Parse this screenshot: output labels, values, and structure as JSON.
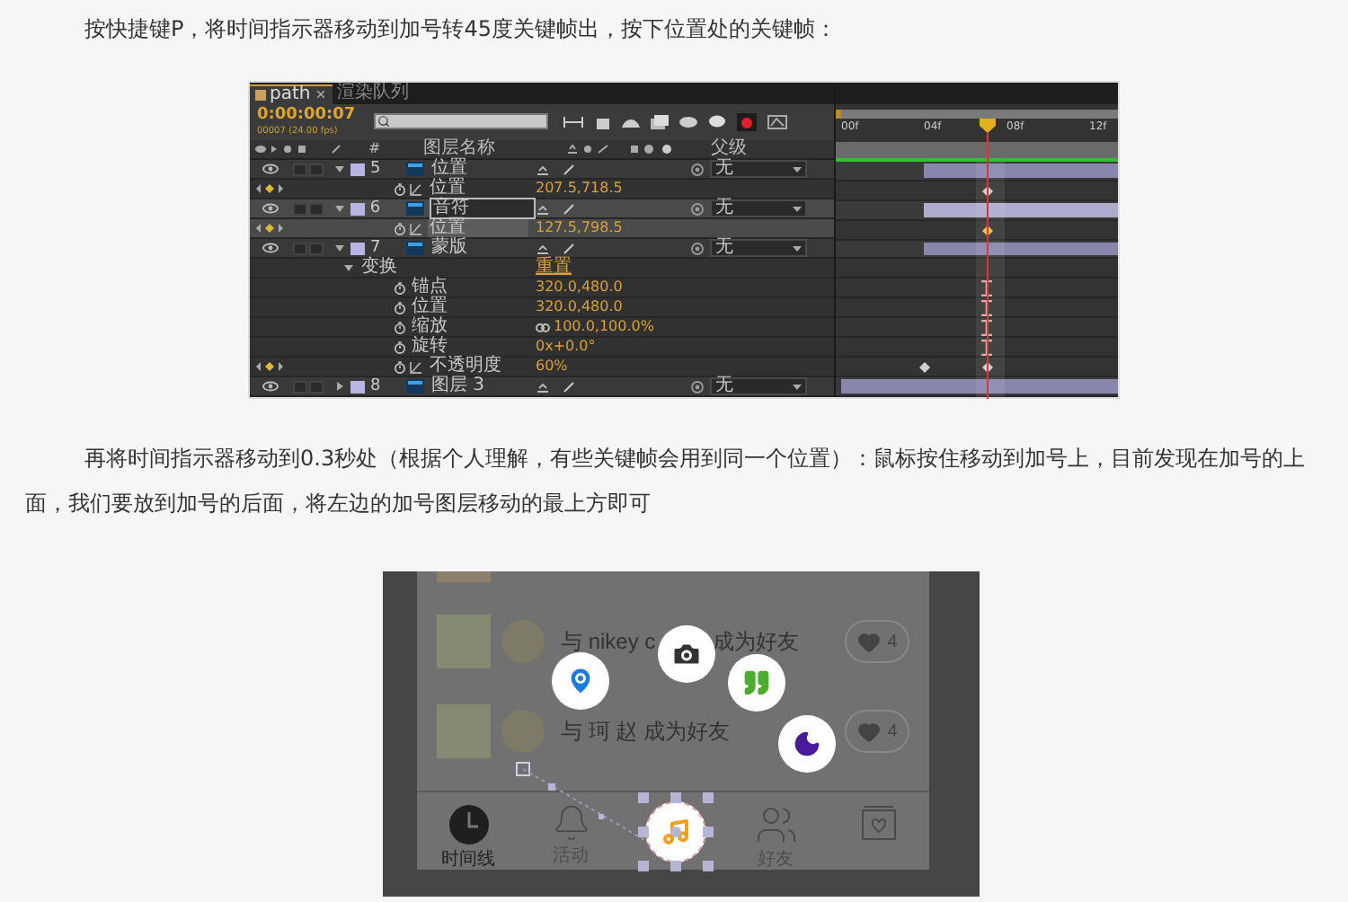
{
  "intro": "按快捷键P，将时间指示器移动到加号转45度关键帧出，按下位置处的关键帧：",
  "ae": {
    "tabs": [
      {
        "label": "path",
        "selected": true
      },
      {
        "label": "渲染队列",
        "selected": false
      }
    ],
    "timecode": "0:00:00:07",
    "fps": "00007 (24.00 fps)",
    "header": {
      "number": "#",
      "layer_name": "图层名称",
      "parent": "父级"
    },
    "ruler": [
      "00f",
      "04f",
      "08f",
      "12f"
    ],
    "rows": [
      {
        "kind": "layer",
        "number": "5",
        "name": "位置",
        "parent": "无",
        "selected": false,
        "expanded": true,
        "bar_from_start": false
      },
      {
        "kind": "property",
        "name": "位置",
        "value": "207.5,718.5",
        "selected": false,
        "keyframes": [
          {
            "kind": "diamond",
            "at_playhead": true
          }
        ]
      },
      {
        "kind": "layer",
        "number": "6",
        "name": "音符",
        "parent": "无",
        "selected": true,
        "expanded": true,
        "bar_from_start": false
      },
      {
        "kind": "property",
        "name": "位置",
        "value": "127.5,798.5",
        "selected": true,
        "keyframes": [
          {
            "kind": "diamond-selected",
            "at_playhead": true
          }
        ]
      },
      {
        "kind": "layer",
        "number": "7",
        "name": "蒙版",
        "parent": "无",
        "selected": false,
        "expanded": true,
        "bar_from_start": false
      },
      {
        "kind": "group",
        "name": "变换",
        "value": "重置"
      },
      {
        "kind": "transform",
        "name": "锚点",
        "value": "320.0,480.0",
        "linked": false,
        "keyframes": [
          {
            "kind": "hold",
            "at_playhead": true
          }
        ]
      },
      {
        "kind": "transform",
        "name": "位置",
        "value": "320.0,480.0",
        "linked": false,
        "keyframes": [
          {
            "kind": "hold",
            "at_playhead": true
          }
        ]
      },
      {
        "kind": "transform",
        "name": "缩放",
        "value": "100.0,100.0%",
        "linked": true,
        "keyframes": [
          {
            "kind": "hold",
            "at_playhead": true
          }
        ]
      },
      {
        "kind": "transform",
        "name": "旋转",
        "value": "0x+0.0°",
        "linked": false,
        "keyframes": [
          {
            "kind": "hold",
            "at_playhead": true
          }
        ]
      },
      {
        "kind": "property",
        "name": "不透明度",
        "value": "60%",
        "selected": false,
        "keyframes": [
          {
            "kind": "diamond",
            "at_playhead": false
          },
          {
            "kind": "diamond",
            "at_playhead": true
          }
        ]
      },
      {
        "kind": "layer",
        "number": "8",
        "name": "图层 3",
        "parent": "无",
        "selected": false,
        "expanded": false,
        "bar_from_start": true
      }
    ]
  },
  "paragraph": "再将时间指示器移动到0.3秒处（根据个人理解，有些关键帧会用到同一个位置）：鼠标按住移动到加号上，目前发现在加号的上面，我们要放到加号的后面，将左边的加号图层移动的最上方即可",
  "phone": {
    "feed": [
      {
        "texts": [
          "与 nikey c",
          "成为好友"
        ],
        "likes": "4"
      },
      {
        "texts": [
          "与 珂 赵 成为好友"
        ],
        "likes": "4"
      }
    ],
    "tabs": [
      {
        "kind": "clock",
        "label": "时间线",
        "selected": true
      },
      {
        "kind": "bell",
        "label": "活动",
        "selected": false
      },
      {
        "kind": "center"
      },
      {
        "kind": "friends",
        "label": "好友",
        "selected": false
      },
      {
        "kind": "box"
      }
    ]
  }
}
